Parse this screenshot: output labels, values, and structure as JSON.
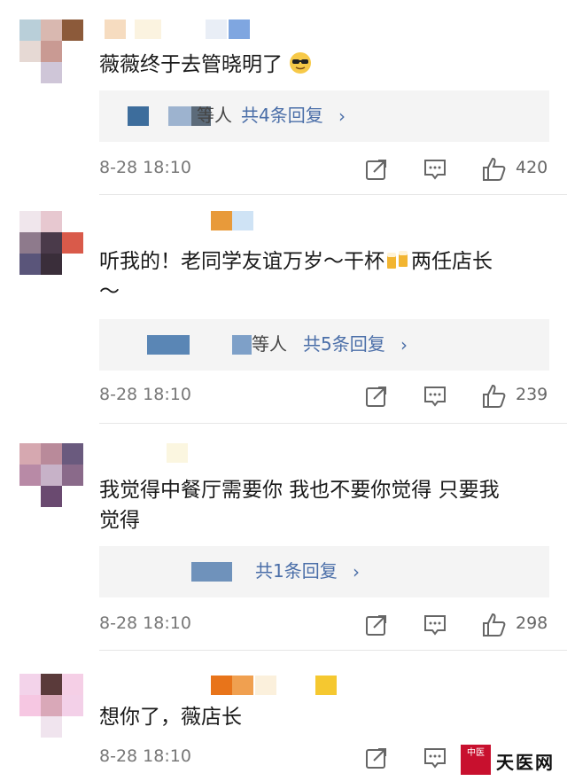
{
  "comments": [
    {
      "text": "薇薇终于去管晓明了",
      "emoji": "sunglasses-emoji",
      "reply_suffix": "等人",
      "reply_count": "共4条回复",
      "chevron": "›",
      "time": "8-28 18:10",
      "likes": "420"
    },
    {
      "text_a": "听我的！老同学友谊万岁～干杯",
      "emoji": "beer-emoji",
      "text_b": "两任店长",
      "text_c": "～",
      "reply_suffix": "等人",
      "reply_count": "共5条回复",
      "chevron": "›",
      "time": "8-28 18:10",
      "likes": "239"
    },
    {
      "text_a": "我觉得中餐厅需要你 我也不要你觉得 只要我",
      "text_b": "觉得",
      "reply_count": "共1条回复",
      "chevron": "›",
      "time": "8-28 18:10",
      "likes": "298"
    },
    {
      "text": "想你了，薇店长",
      "time": "8-28 18:10",
      "likes": ""
    }
  ],
  "watermark": {
    "seal": "中医",
    "text": "天医网"
  },
  "colors": {
    "link": "#4a6ea8",
    "reply_bg": "#f4f4f4",
    "meta": "#777777"
  }
}
